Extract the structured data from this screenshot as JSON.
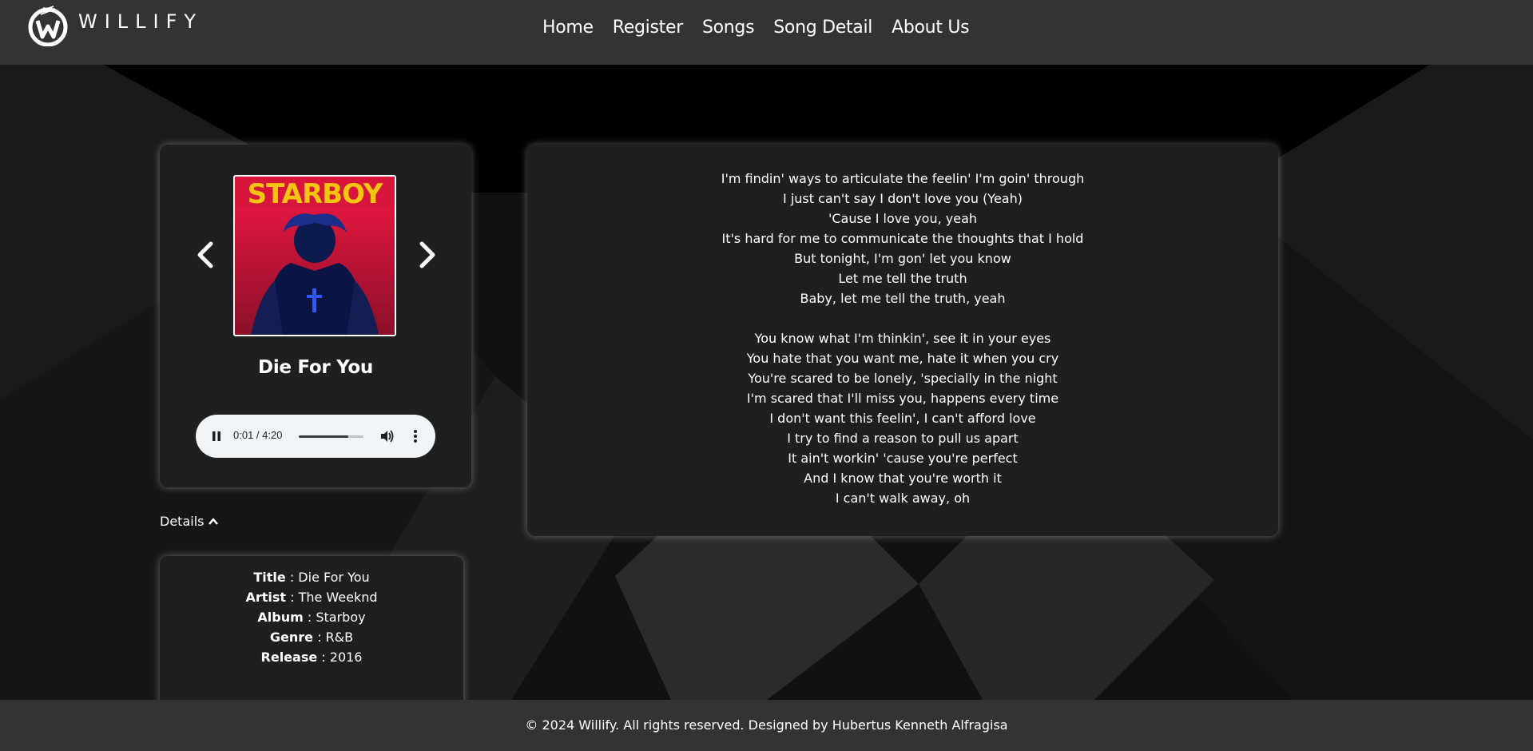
{
  "brand": {
    "name": "WILLIFY"
  },
  "nav": {
    "items": [
      {
        "label": "Home"
      },
      {
        "label": "Register"
      },
      {
        "label": "Songs"
      },
      {
        "label": "Song Detail"
      },
      {
        "label": "About Us"
      }
    ]
  },
  "player": {
    "cover_text": "STARBOY",
    "song_title": "Die For You",
    "time_display": "0:01 / 4:20",
    "progress_fraction": 0.77,
    "prev_icon": "chevron-left-icon",
    "next_icon": "chevron-right-icon"
  },
  "details": {
    "toggle_label": "Details",
    "rows": [
      {
        "label": "Title",
        "value": "Die For You"
      },
      {
        "label": "Artist",
        "value": "The Weeknd"
      },
      {
        "label": "Album",
        "value": "Starboy"
      },
      {
        "label": "Genre",
        "value": "R&B"
      },
      {
        "label": "Release",
        "value": "2016"
      }
    ]
  },
  "lyrics": {
    "lines": [
      "I'm findin' ways to articulate the feelin' I'm goin' through",
      "I just can't say I don't love you (Yeah)",
      "'Cause I love you, yeah",
      "It's hard for me to communicate the thoughts that I hold",
      "But tonight, I'm gon' let you know",
      "Let me tell the truth",
      "Baby, let me tell the truth, yeah",
      "",
      "You know what I'm thinkin', see it in your eyes",
      "You hate that you want me, hate it when you cry",
      "You're scared to be lonely, 'specially in the night",
      "I'm scared that I'll miss you, happens every time",
      "I don't want this feelin', I can't afford love",
      "I try to find a reason to pull us apart",
      "It ain't workin' 'cause you're perfect",
      "And I know that you're worth it",
      "I can't walk away, oh"
    ]
  },
  "footer": {
    "text": "© 2024 Willify. All rights reserved. Designed by Hubertus Kenneth Alfragisa"
  }
}
